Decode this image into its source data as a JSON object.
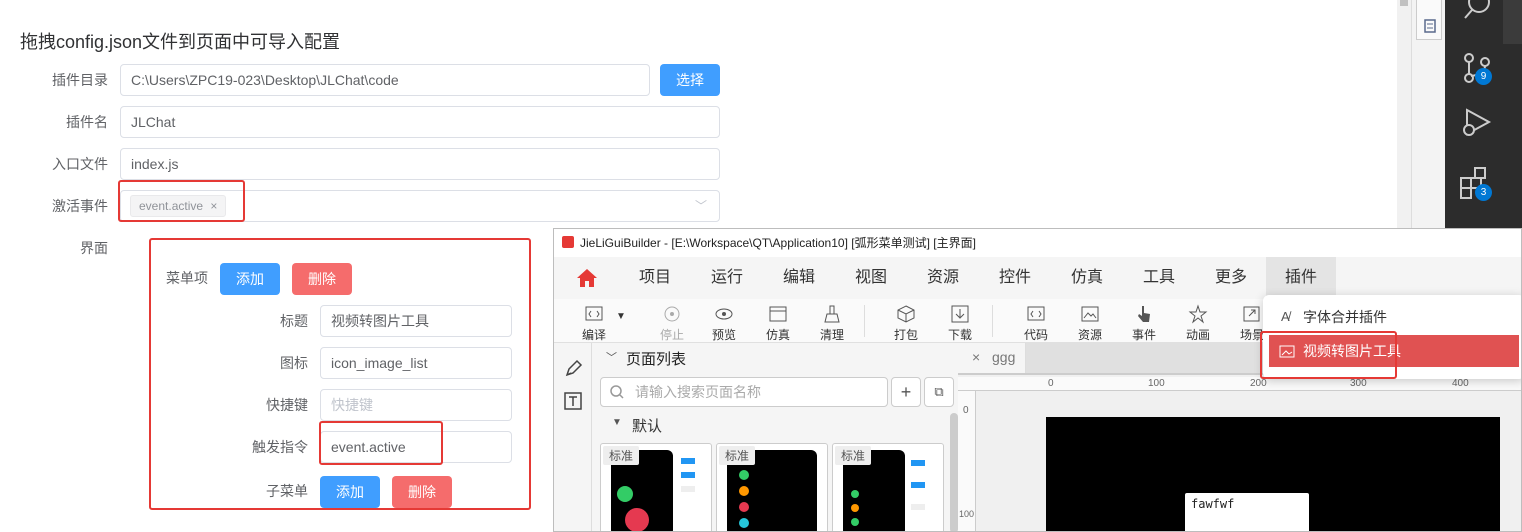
{
  "form": {
    "title": "拖拽config.json文件到页面中可导入配置",
    "plugin_dir_label": "插件目录",
    "plugin_dir_value": "C:\\Users\\ZPC19-023\\Desktop\\JLChat\\code",
    "select_button": "选择",
    "plugin_name_label": "插件名",
    "plugin_name_value": "JLChat",
    "entry_label": "入口文件",
    "entry_value": "index.js",
    "activation_label": "激活事件",
    "activation_tag": "event.active",
    "ui_label": "界面"
  },
  "menu_editor": {
    "menu_items_label": "菜单项",
    "add_label": "添加",
    "delete_label": "删除",
    "title_label": "标题",
    "title_value": "视频转图片工具",
    "icon_label": "图标",
    "icon_value": "icon_image_list",
    "shortcut_label": "快捷键",
    "shortcut_placeholder": "快捷键",
    "trigger_label": "触发指令",
    "trigger_value": "event.active",
    "submenu_label": "子菜单",
    "submenu_add": "添加",
    "submenu_delete": "删除"
  },
  "vscode": {
    "scm_badge": "9",
    "ext_badge": "3"
  },
  "builder": {
    "title": "JieLiGuiBuilder - [E:\\Workspace\\QT\\Application10] [弧形菜单测试] [主界面]",
    "menu": [
      "项目",
      "运行",
      "编辑",
      "视图",
      "资源",
      "控件",
      "仿真",
      "工具",
      "更多",
      "插件"
    ],
    "tools": [
      "编译",
      "停止",
      "预览",
      "仿真",
      "清理",
      "打包",
      "下载",
      "代码",
      "资源",
      "事件",
      "动画",
      "场景"
    ],
    "dropdown": [
      "字体合并插件",
      "视频转图片工具"
    ],
    "page_list_title": "页面列表",
    "search_placeholder": "请输入搜索页面名称",
    "group_default": "默认",
    "thumb_label": "标准",
    "tab_name": "ggg",
    "ruler_top": [
      "0",
      "100",
      "200",
      "300",
      "400"
    ],
    "ruler_left": [
      "0",
      "100"
    ],
    "canvas_text": "fawfwf"
  }
}
